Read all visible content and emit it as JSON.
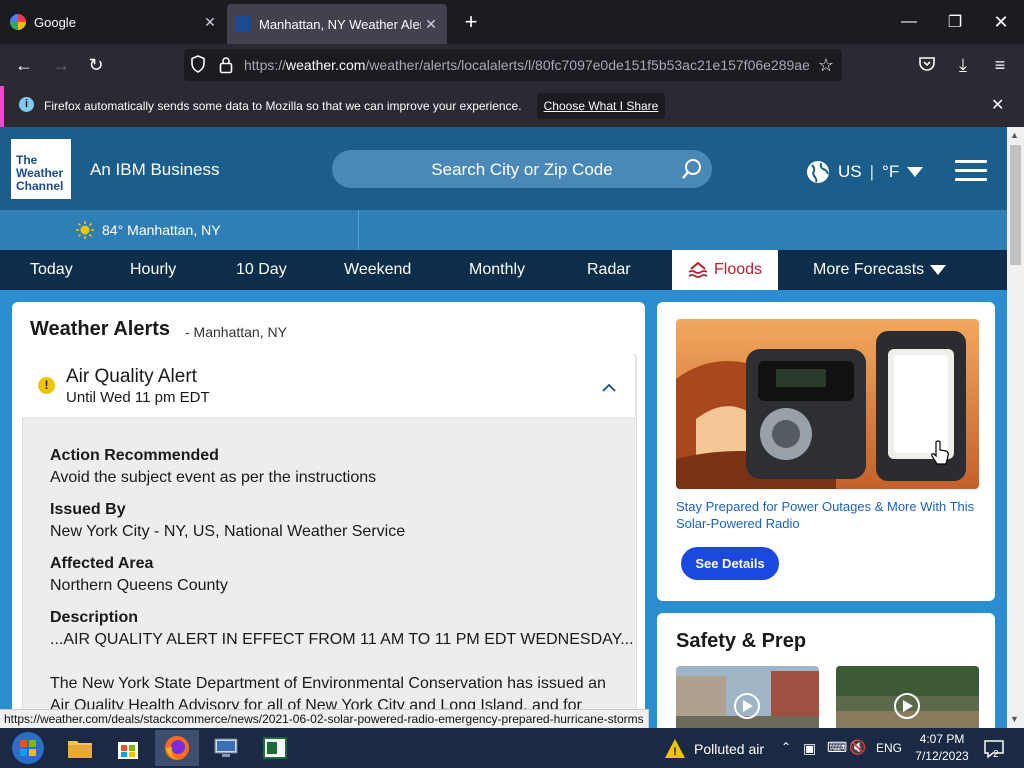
{
  "browser": {
    "tabs": [
      {
        "title": "Google",
        "active": false
      },
      {
        "title": "Manhattan, NY Weather Alerts",
        "active": true
      }
    ],
    "url_prefix": "https://",
    "url_domain": "weather.com",
    "url_path": "/weather/alerts/localalerts/l/80fc7097e0de151f5b53ac21e157f06e289ae",
    "notification": {
      "message": "Firefox automatically sends some data to Mozilla so that we can improve your experience.",
      "button": "Choose What I Share"
    },
    "status_url": "https://weather.com/deals/stackcommerce/news/2021-06-02-solar-powered-radio-emergency-prepared-hurricane-storms"
  },
  "site": {
    "logo_lines": [
      "The",
      "Weather",
      "Channel"
    ],
    "tagline": "An IBM Business",
    "search_placeholder": "Search City or Zip Code",
    "locale_country": "US",
    "locale_unit": "°F",
    "current_temp": "84°",
    "current_location": "Manhattan, NY",
    "nav": [
      "Today",
      "Hourly",
      "10 Day",
      "Weekend",
      "Monthly",
      "Radar",
      "Floods",
      "More Forecasts"
    ]
  },
  "alerts": {
    "title": "Weather Alerts",
    "location": "- Manhattan, NY",
    "alert_name": "Air Quality Alert",
    "alert_until": "Until Wed 11 pm EDT",
    "action_label": "Action Recommended",
    "action_value": "Avoid the subject event as per the instructions",
    "issued_label": "Issued By",
    "issued_value": "New York City - NY, US, National Weather Service",
    "area_label": "Affected Area",
    "area_value": "Northern Queens County",
    "desc_label": "Description",
    "desc_line1": "...AIR QUALITY ALERT IN EFFECT FROM 11 AM TO 11 PM EDT WEDNESDAY...",
    "desc_line2": "The New York State Department of Environmental Conservation has issued an",
    "desc_line3": "Air Quality Health Advisory for all of New York City and Long Island, and for"
  },
  "ad": {
    "text": "Stay Prepared for Power Outages & More With This Solar-Powered Radio",
    "button": "See Details"
  },
  "safety": {
    "title": "Safety & Prep"
  },
  "taskbar": {
    "weather": "Polluted air",
    "lang": "ENG",
    "time": "4:07 PM",
    "date": "7/12/2023",
    "notif_count": "2"
  }
}
